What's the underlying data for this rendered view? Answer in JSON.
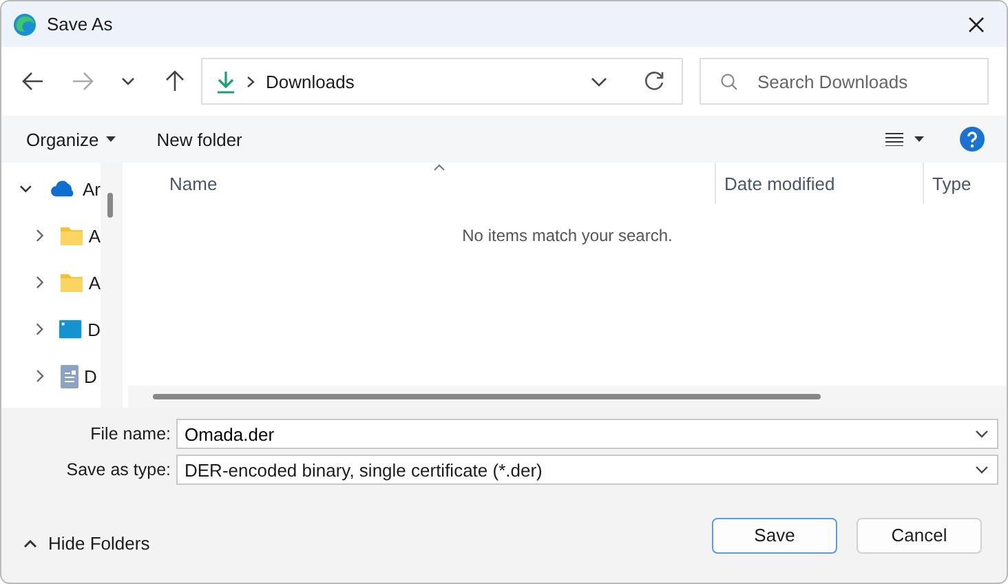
{
  "window": {
    "title": "Save As"
  },
  "nav": {
    "location": "Downloads",
    "search_placeholder": "Search Downloads"
  },
  "toolbar": {
    "organize": "Organize",
    "new_folder": "New folder"
  },
  "sidebar": {
    "items": [
      {
        "label": "Ar",
        "kind": "cloud",
        "expanded": true
      },
      {
        "label": "A",
        "kind": "folder",
        "expanded": false
      },
      {
        "label": "A",
        "kind": "folder",
        "expanded": false
      },
      {
        "label": "D",
        "kind": "desktop",
        "expanded": false
      },
      {
        "label": "D",
        "kind": "document",
        "expanded": false
      }
    ]
  },
  "table": {
    "columns": [
      "Name",
      "Date modified",
      "Type"
    ],
    "empty_message": "No items match your search."
  },
  "form": {
    "file_name_label": "File name:",
    "file_name": "Omada.der",
    "type_label": "Save as type:",
    "type_value": "DER-encoded binary, single certificate (*.der)"
  },
  "footer": {
    "hide_folders": "Hide Folders",
    "buttons": [
      "Save",
      "Cancel"
    ]
  }
}
